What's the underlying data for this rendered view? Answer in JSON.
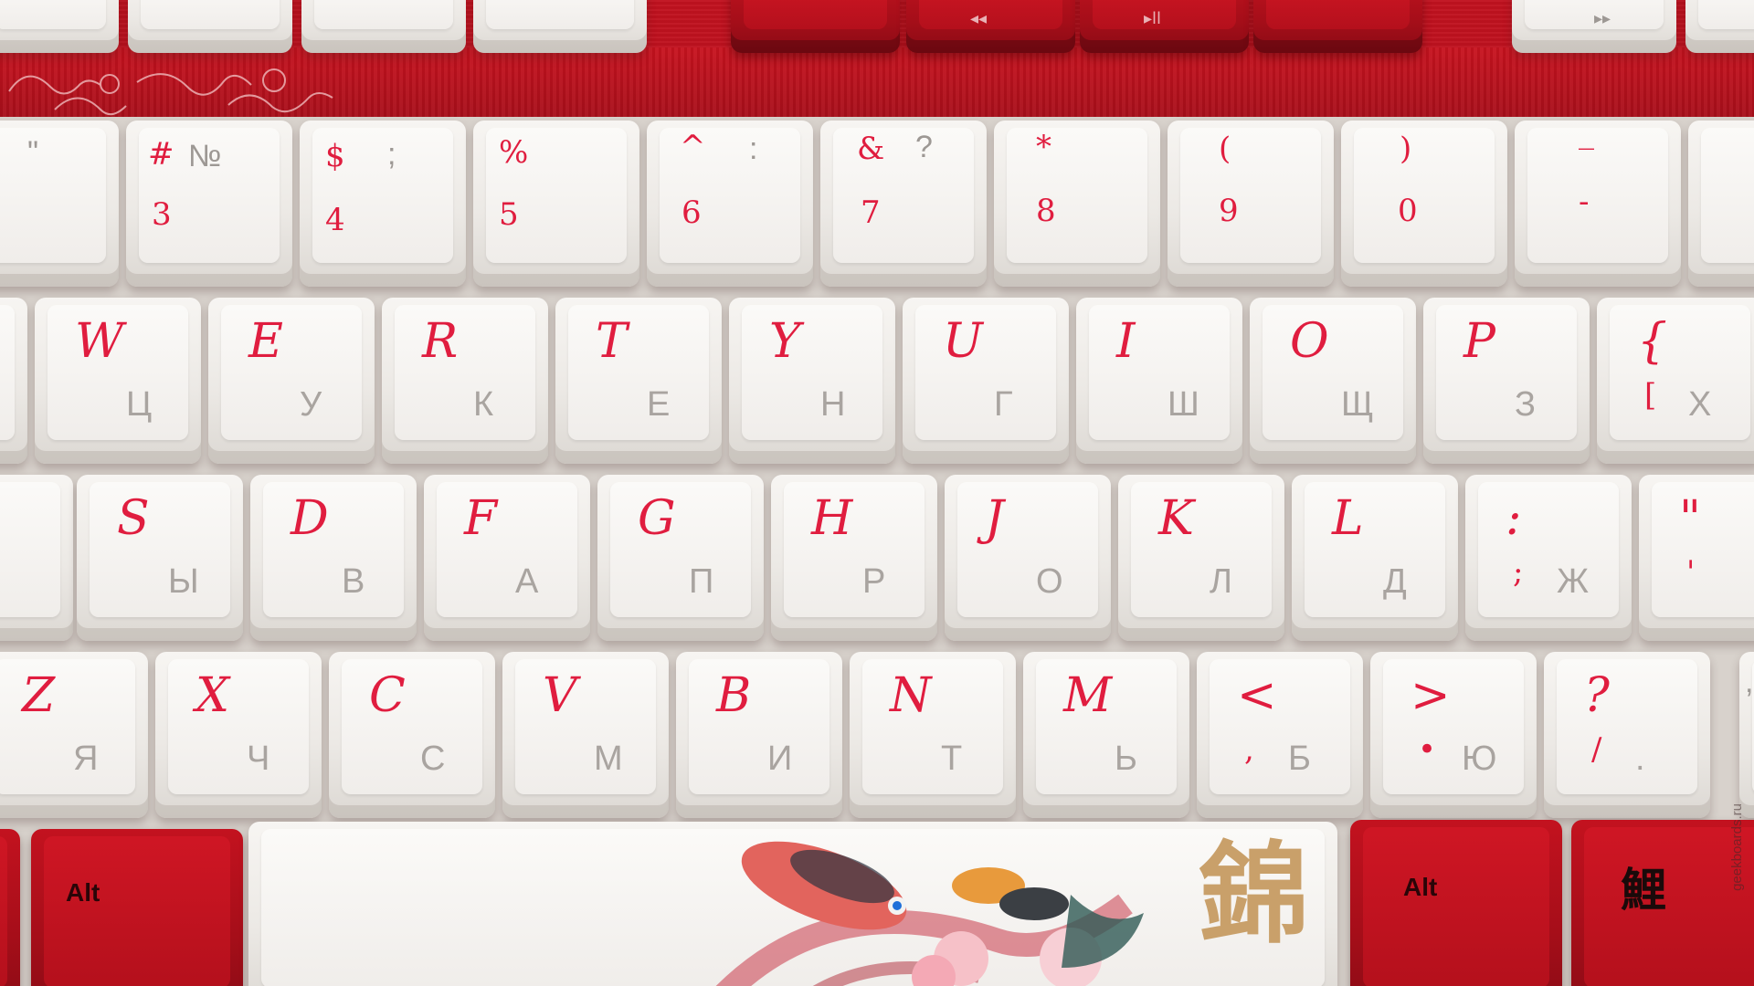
{
  "photo": {
    "subject": "keyboard-close-up",
    "colors": {
      "accent_red": "#e01d3f",
      "case_red": "#b3111e",
      "cap_white": "#f3f1ee",
      "gold": "#c9a06a"
    }
  },
  "media_row": {
    "prev_icon": "◂◂",
    "play_icon": "▸ll",
    "next_icon": "▸▸"
  },
  "number_row": {
    "k1": {
      "top": "\""
    },
    "k3": {
      "top": "#",
      "top_ru": "№",
      "bottom": "3"
    },
    "k4": {
      "top": "$",
      "top_ru": ";",
      "bottom": "4"
    },
    "k5": {
      "top": "%",
      "bottom": "5"
    },
    "k6": {
      "top": "^",
      "top_ru": ":",
      "bottom": "6"
    },
    "k7": {
      "top": "&",
      "top_ru": "?",
      "bottom": "7"
    },
    "k8": {
      "top": "*",
      "bottom": "8"
    },
    "k9": {
      "top": "(",
      "bottom": "9"
    },
    "k0": {
      "top": ")",
      "bottom": "0"
    },
    "kminus": {
      "top": "_",
      "bottom": "-"
    }
  },
  "row_q": [
    {
      "en": "W",
      "ru": "Ц"
    },
    {
      "en": "E",
      "ru": "У"
    },
    {
      "en": "R",
      "ru": "К"
    },
    {
      "en": "T",
      "ru": "Е"
    },
    {
      "en": "Y",
      "ru": "Н"
    },
    {
      "en": "U",
      "ru": "Г"
    },
    {
      "en": "I",
      "ru": "Ш"
    },
    {
      "en": "O",
      "ru": "Щ"
    },
    {
      "en": "P",
      "ru": "З"
    },
    {
      "en": "{",
      "en2": "[",
      "ru": "Х"
    }
  ],
  "row_a": [
    {
      "en": "S",
      "ru": "Ы"
    },
    {
      "en": "D",
      "ru": "В"
    },
    {
      "en": "F",
      "ru": "А"
    },
    {
      "en": "G",
      "ru": "П"
    },
    {
      "en": "H",
      "ru": "Р"
    },
    {
      "en": "J",
      "ru": "О"
    },
    {
      "en": "K",
      "ru": "Л"
    },
    {
      "en": "L",
      "ru": "Д"
    },
    {
      "en": ":",
      "en2": ";",
      "ru": "Ж"
    },
    {
      "en": "\"",
      "en2": "'",
      "ru": ""
    }
  ],
  "row_z": [
    {
      "en": "Z",
      "ru": "Я"
    },
    {
      "en": "X",
      "ru": "Ч"
    },
    {
      "en": "C",
      "ru": "С"
    },
    {
      "en": "V",
      "ru": "М"
    },
    {
      "en": "B",
      "ru": "И"
    },
    {
      "en": "N",
      "ru": "Т"
    },
    {
      "en": "M",
      "ru": "Ь"
    },
    {
      "en": "<",
      "en2": ",",
      "ru": "Б"
    },
    {
      "en": ">",
      "en2": "•",
      "ru": "Ю"
    },
    {
      "en": "?",
      "en2": "/",
      "ru": "."
    }
  ],
  "row_z_extra": {
    "comma": ","
  },
  "bottom_row": {
    "alt_left": "Alt",
    "alt_right": "Alt",
    "space_glyph": "錦",
    "right_glyph": "鯉"
  },
  "watermark": "geekboards.ru"
}
